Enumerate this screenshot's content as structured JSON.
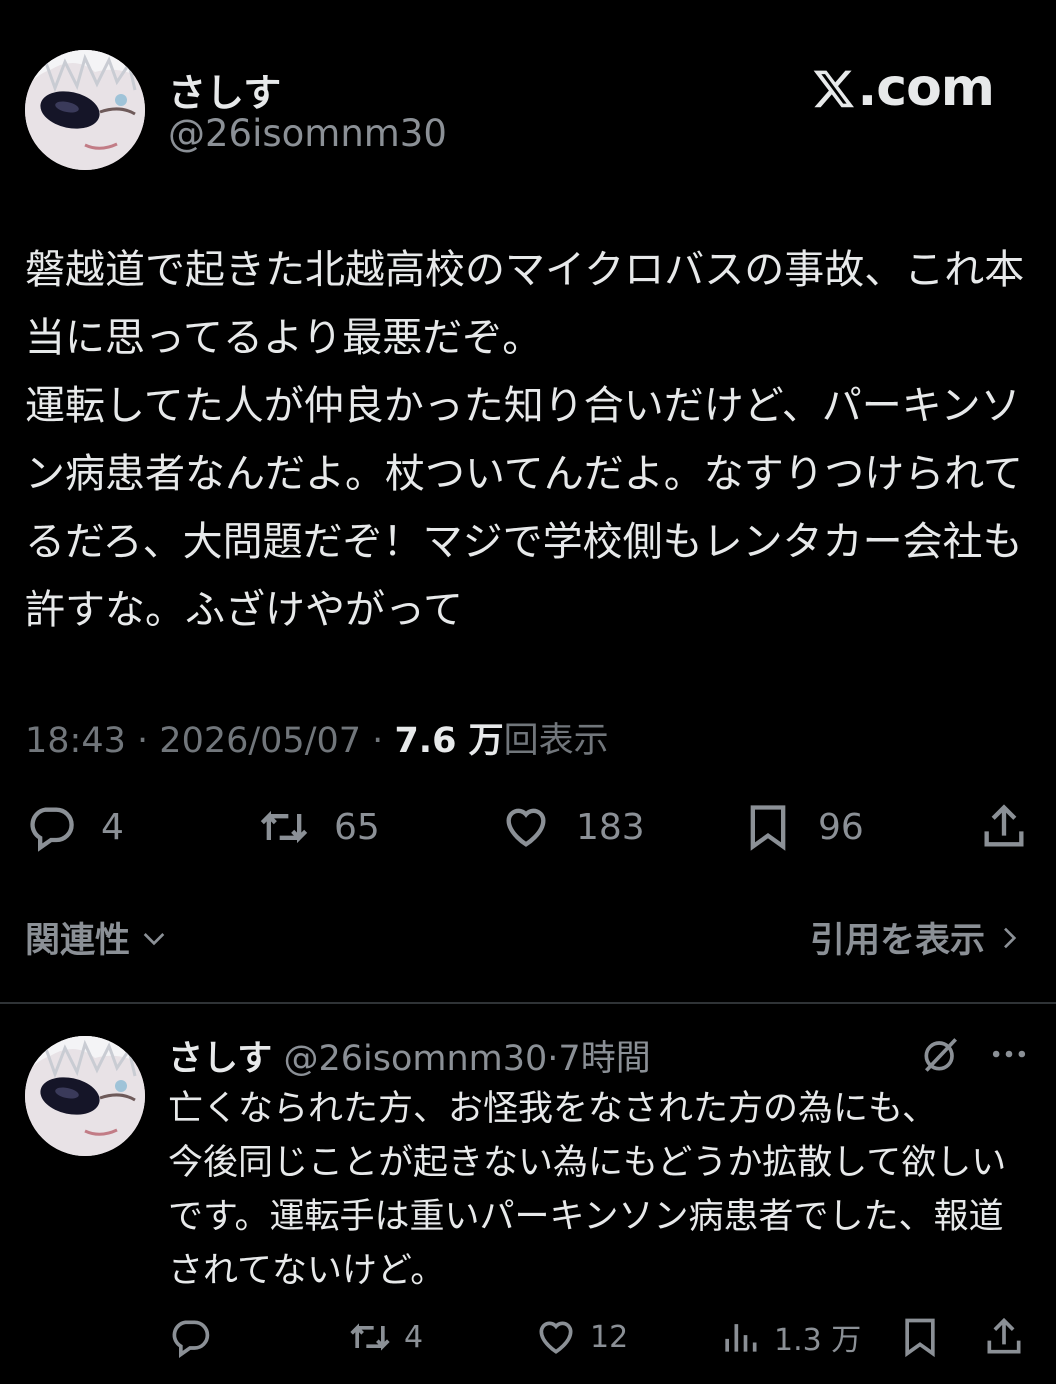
{
  "post": {
    "author": {
      "display_name": "さしす",
      "handle": "@26isomnm30"
    },
    "brand": ".com",
    "text": "磐越道で起きた北越高校のマイクロバスの事故、これ本当に思ってるより最悪だぞ。\n運転してた人が仲良かった知り合いだけど、パーキンソン病患者なんだよ。杖ついてんだよ。なすりつけられてるだろ、大問題だぞ！マジで学校側もレンタカー会社も許すな。ふざけやがって",
    "time": "18:43",
    "date": "2026/05/07",
    "separator": "·",
    "views_count": "7.6 万",
    "views_label": "回表示",
    "stats": {
      "replies": "4",
      "retweets": "65",
      "likes": "183",
      "bookmarks": "96"
    }
  },
  "filters": {
    "sort_label": "関連性",
    "quotes_label": "引用を表示"
  },
  "reply": {
    "display_name": "さしす",
    "handle": "@26isomnm30",
    "separator": "·",
    "time": "7時間",
    "text": "亡くなられた方、お怪我をなされた方の為にも、\n今後同じことが起きない為にもどうか拡散して欲しいです。運転手は重いパーキンソン病患者でした、報道されてないけど。",
    "stats": {
      "retweets": "4",
      "likes": "12",
      "views": "1.3 万"
    }
  },
  "colors": {
    "background": "#000000",
    "text_primary": "#e7e9ea",
    "text_secondary": "#8b9096",
    "divider": "#2f3336"
  }
}
